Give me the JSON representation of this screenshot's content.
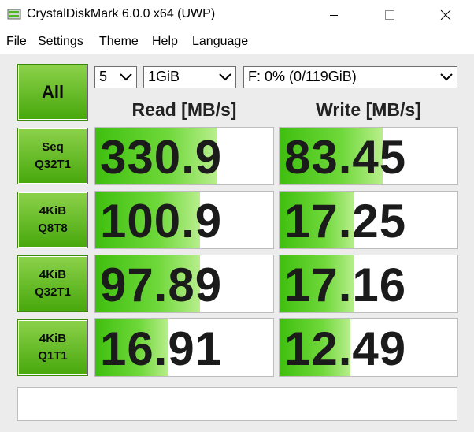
{
  "window": {
    "title": "CrystalDiskMark 6.0.0 x64 (UWP)",
    "icons": [
      "app-drive-icon",
      "minimize-icon",
      "maximize-icon",
      "close-icon"
    ]
  },
  "menu": {
    "items": [
      "File",
      "Settings",
      "Theme",
      "Help",
      "Language"
    ]
  },
  "controls": {
    "all_label": "All",
    "count_value": "5",
    "size_value": "1GiB",
    "drive_value": "F: 0% (0/119GiB)"
  },
  "headers": {
    "read": "Read [MB/s]",
    "write": "Write [MB/s]"
  },
  "tests": [
    {
      "line1": "Seq",
      "line2": "Q32T1",
      "read": "330.9",
      "write": "83.45",
      "read_fill": 0.68,
      "write_fill": 0.58
    },
    {
      "line1": "4KiB",
      "line2": "Q8T8",
      "read": "100.9",
      "write": "17.25",
      "read_fill": 0.59,
      "write_fill": 0.42
    },
    {
      "line1": "4KiB",
      "line2": "Q32T1",
      "read": "97.89",
      "write": "17.16",
      "read_fill": 0.59,
      "write_fill": 0.42
    },
    {
      "line1": "4KiB",
      "line2": "Q1T1",
      "read": "16.91",
      "write": "12.49",
      "read_fill": 0.41,
      "write_fill": 0.4
    }
  ],
  "colors": {
    "bar_green": "#3fbf0f",
    "button_green": "#48a80c"
  },
  "status_text": ""
}
